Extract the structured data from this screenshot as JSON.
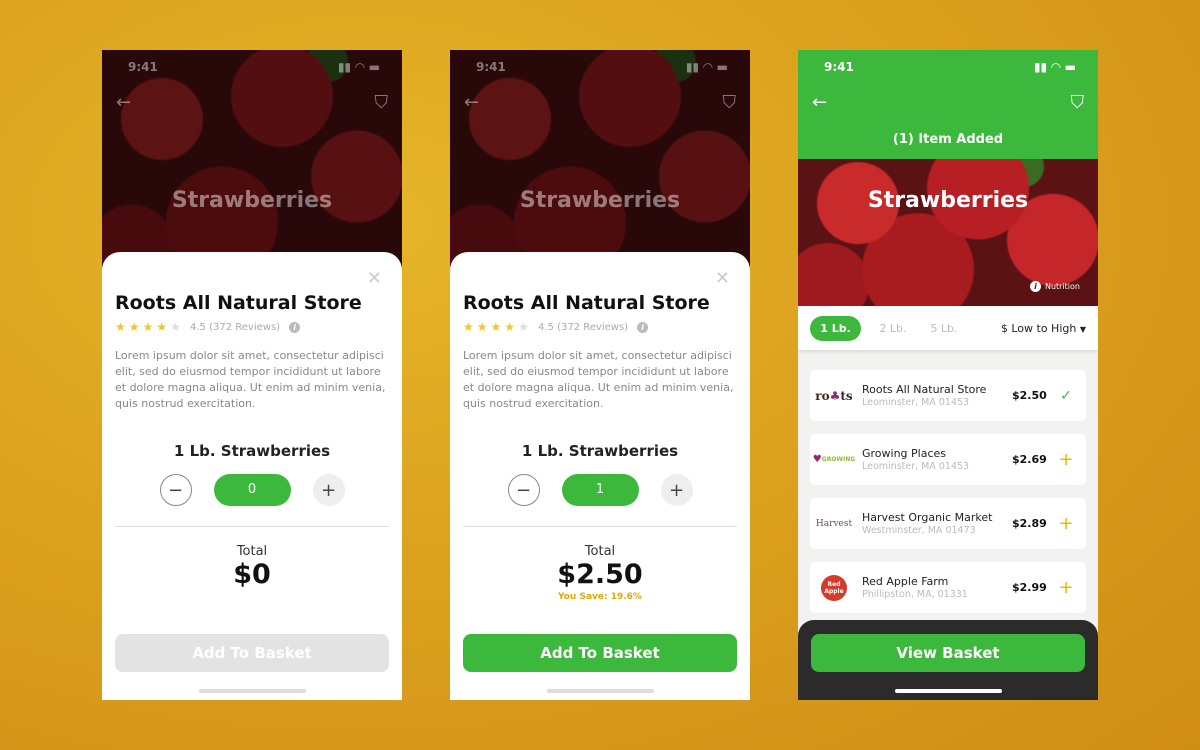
{
  "status_time": "9:41",
  "product_title": "Strawberries",
  "sheet": {
    "store": "Roots All Natural Store",
    "rating": 4.5,
    "rating_text": "4.5 (372 Reviews)",
    "description": "Lorem ipsum dolor sit amet, consectetur adipisci elit, sed do eiusmod tempor incididunt ut labore et dolore magna aliqua. Ut enim ad minim venia, quis nostrud exercitation.",
    "product": "1 Lb. Strawberries",
    "total_label": "Total",
    "add_label": "Add To Basket"
  },
  "screen1": {
    "qty": "0",
    "total": "$0"
  },
  "screen2": {
    "qty": "1",
    "total": "$2.50",
    "savings": "You Save: 19.6%"
  },
  "screen3": {
    "banner": "(1) Item Added",
    "nutrition": "Nutrition",
    "weights": [
      "1 Lb.",
      "2 Lb.",
      "5 Lb."
    ],
    "selected_weight": "1 Lb.",
    "sort": "$ Low to High",
    "view_basket": "View Basket",
    "stores": [
      {
        "name": "Roots All Natural Store",
        "address": "Leominster, MA 01453",
        "price": "$2.50",
        "logo": "roots",
        "added": true
      },
      {
        "name": "Growing Places",
        "address": "Leominster, MA 01453",
        "price": "$2.69",
        "logo": "GROWING PLACES",
        "added": false
      },
      {
        "name": "Harvest Organic Market",
        "address": "Westminster, MA 01473",
        "price": "$2.89",
        "logo": "Harvest",
        "added": false
      },
      {
        "name": "Red Apple Farm",
        "address": "Phillipston, MA, 01331",
        "price": "$2.99",
        "logo": "Red Apple Farm",
        "added": false
      }
    ]
  },
  "colors": {
    "accent": "#3cb93c",
    "savings": "#e1a800",
    "star": "#f5c330",
    "add_icon": "#f5b400"
  }
}
